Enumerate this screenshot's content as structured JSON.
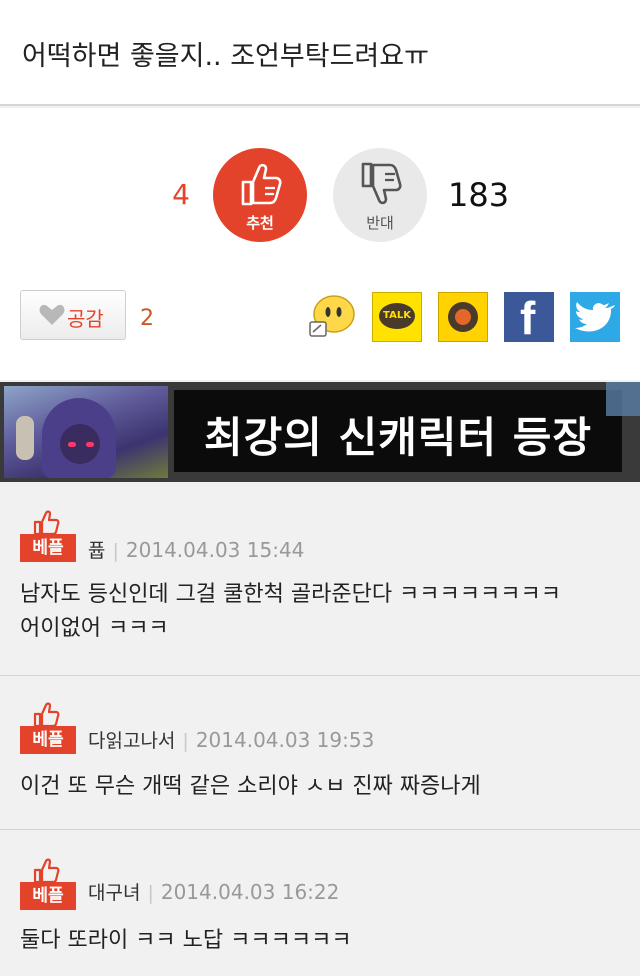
{
  "post": {
    "title": "어떡하면 좋을지.. 조언부탁드려요ㅠ"
  },
  "vote": {
    "up_count": "4",
    "up_label": "추천",
    "down_label": "반대",
    "down_count": "183",
    "up_color": "#e4432b"
  },
  "empathy": {
    "label": "공감",
    "count": "2"
  },
  "share": [
    "emoticon-icon",
    "kakaotalk-icon",
    "kakaostory-icon",
    "facebook-icon",
    "twitter-icon"
  ],
  "share_labels": {
    "kakao": "TALK",
    "facebook": "f"
  },
  "banner": {
    "text": "최강의 신캐릭터 등장"
  },
  "comments": [
    {
      "badge": "베플",
      "nick": "퓹",
      "date": "2014.04.03 15:44",
      "lines": [
        "남자도 등신인데 그걸 쿨한척 골라준단다 ㅋㅋㅋㅋㅋㅋㅋㅋ",
        "어이없어 ㅋㅋㅋ"
      ]
    },
    {
      "badge": "베플",
      "nick": "다읽고나서",
      "date": "2014.04.03 19:53",
      "lines": [
        "이건 또 무슨 개떡 같은 소리야 ㅅㅂ 진짜 짜증나게"
      ]
    },
    {
      "badge": "베플",
      "nick": "대구녀",
      "date": "2014.04.03 16:22",
      "lines": [
        "둘다 또라이 ㅋㅋ 노답 ㅋㅋㅋㅋㅋㅋ"
      ]
    }
  ]
}
